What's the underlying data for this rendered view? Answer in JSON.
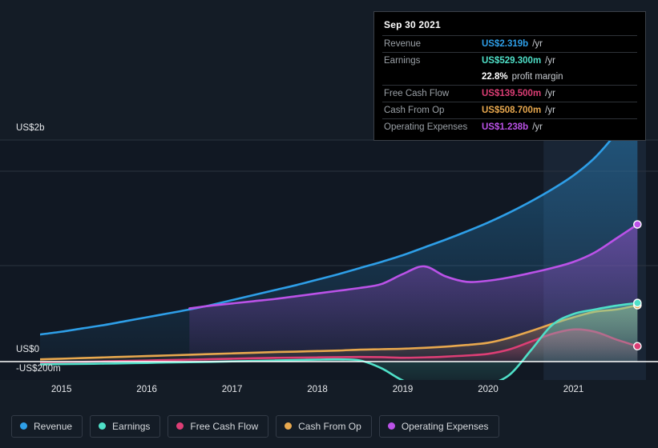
{
  "colors": {
    "background": "#141c26",
    "revenue": "#2e9fe8",
    "earnings": "#4fe0c8",
    "free_cash_flow": "#dd3e75",
    "cash_from_op": "#e8a84e",
    "operating_expenses": "#bb52e8",
    "zero_line": "#ffffff",
    "grid": "#2a333f",
    "muted_text": "#9aa0a6"
  },
  "tooltip": {
    "title": "Sep 30 2021",
    "rows": [
      {
        "label": "Revenue",
        "value": "US$2.319b",
        "suffix": "/yr",
        "color": "#2e9fe8"
      },
      {
        "label": "Earnings",
        "value": "US$529.300m",
        "suffix": "/yr",
        "color": "#4fe0c8"
      },
      {
        "label": "",
        "value": "22.8%",
        "suffix": "profit margin",
        "color": "#ffffff"
      },
      {
        "label": "Free Cash Flow",
        "value": "US$139.500m",
        "suffix": "/yr",
        "color": "#dd3e75"
      },
      {
        "label": "Cash From Op",
        "value": "US$508.700m",
        "suffix": "/yr",
        "color": "#e8a84e"
      },
      {
        "label": "Operating Expenses",
        "value": "US$1.238b",
        "suffix": "/yr",
        "color": "#bb52e8"
      }
    ]
  },
  "legend": {
    "items": [
      {
        "label": "Revenue",
        "color": "#2e9fe8"
      },
      {
        "label": "Earnings",
        "color": "#4fe0c8"
      },
      {
        "label": "Free Cash Flow",
        "color": "#dd3e75"
      },
      {
        "label": "Cash From Op",
        "color": "#e8a84e"
      },
      {
        "label": "Operating Expenses",
        "color": "#bb52e8"
      }
    ]
  },
  "axis": {
    "y_top_label": "US$2b",
    "y_zero_label": "US$0",
    "y_neg_label": "-US$200m",
    "x_ticks": [
      "2015",
      "2016",
      "2017",
      "2018",
      "2019",
      "2020",
      "2021"
    ]
  },
  "chart_data": {
    "type": "area",
    "title": "",
    "subtitle": "",
    "xlabel": "",
    "ylabel": "",
    "grid": true,
    "legend_position": "bottom",
    "ylim": [
      -300,
      2400
    ],
    "y_unit": "US$ millions",
    "y_ticks": [
      {
        "value": 2000,
        "label": "US$2b"
      },
      {
        "value": 0,
        "label": "US$0"
      },
      {
        "value": -200,
        "label": "-US$200m"
      }
    ],
    "xlim": [
      2014.75,
      2021.85
    ],
    "x_ticks": [
      2015,
      2016,
      2017,
      2018,
      2019,
      2020,
      2021
    ],
    "highlight_band": {
      "from": 2020.65,
      "to": 2021.85
    },
    "x": [
      2014.75,
      2015.0,
      2015.25,
      2015.5,
      2015.75,
      2016.0,
      2016.25,
      2016.5,
      2016.75,
      2017.0,
      2017.25,
      2017.5,
      2017.75,
      2018.0,
      2018.25,
      2018.5,
      2018.75,
      2019.0,
      2019.25,
      2019.5,
      2019.75,
      2020.0,
      2020.25,
      2020.5,
      2020.75,
      2021.0,
      2021.25,
      2021.5,
      2021.75
    ],
    "series": [
      {
        "name": "Revenue",
        "color": "#2e9fe8",
        "values": [
          245,
          270,
          300,
          330,
          365,
          400,
          435,
          470,
          510,
          555,
          600,
          645,
          690,
          740,
          790,
          845,
          900,
          960,
          1030,
          1100,
          1175,
          1255,
          1345,
          1445,
          1555,
          1680,
          1840,
          2060,
          2319
        ]
      },
      {
        "name": "Earnings",
        "color": "#4fe0c8",
        "values": [
          -25,
          -22,
          -20,
          -18,
          -15,
          -12,
          -8,
          -5,
          -2,
          2,
          6,
          10,
          14,
          18,
          20,
          10,
          -60,
          -170,
          -225,
          -228,
          -220,
          -205,
          -120,
          100,
          330,
          430,
          470,
          505,
          529
        ]
      },
      {
        "name": "Free Cash Flow",
        "color": "#dd3e75",
        "values": [
          -8,
          -5,
          -2,
          2,
          6,
          10,
          14,
          18,
          22,
          26,
          30,
          34,
          36,
          38,
          40,
          42,
          40,
          35,
          38,
          45,
          55,
          70,
          110,
          180,
          250,
          290,
          270,
          200,
          139
        ]
      },
      {
        "name": "Cash From Op",
        "color": "#e8a84e",
        "values": [
          20,
          26,
          32,
          38,
          44,
          50,
          56,
          62,
          68,
          74,
          80,
          86,
          90,
          95,
          100,
          108,
          112,
          116,
          124,
          135,
          150,
          170,
          215,
          275,
          340,
          400,
          450,
          470,
          509
        ]
      },
      {
        "name": "Operating Expenses",
        "color": "#bb52e8",
        "values": [
          null,
          null,
          null,
          null,
          null,
          null,
          null,
          480,
          505,
          525,
          545,
          565,
          590,
          615,
          640,
          665,
          700,
          790,
          860,
          770,
          720,
          730,
          760,
          800,
          845,
          900,
          985,
          1110,
          1238
        ]
      }
    ],
    "end_point_markers": [
      {
        "series": "Revenue",
        "x": 2021.75,
        "y": 2319
      },
      {
        "series": "Operating Expenses",
        "x": 2021.75,
        "y": 1238
      },
      {
        "series": "Cash From Op",
        "x": 2021.75,
        "y": 509
      },
      {
        "series": "Earnings",
        "x": 2021.75,
        "y": 529
      },
      {
        "series": "Free Cash Flow",
        "x": 2021.75,
        "y": 139
      }
    ]
  }
}
